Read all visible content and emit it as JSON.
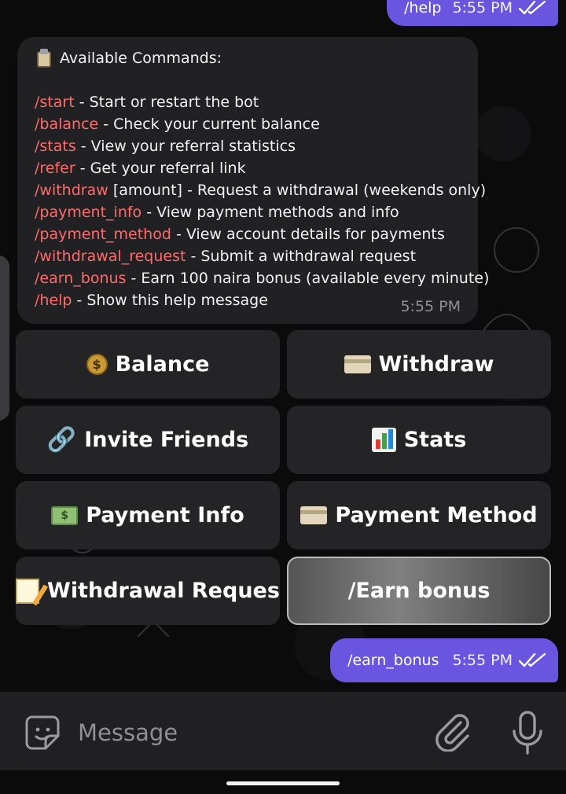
{
  "messages": {
    "outgoing_top": {
      "text": "/help",
      "time": "5:55 PM"
    },
    "help_message": {
      "title": "Available Commands:",
      "commands": [
        {
          "command": "/start",
          "description": " - Start or restart the bot"
        },
        {
          "command": "/balance",
          "description": " - Check your current balance"
        },
        {
          "command": "/stats",
          "description": " - View your referral statistics"
        },
        {
          "command": "/refer",
          "description": " - Get your referral link"
        },
        {
          "command": "/withdraw",
          "description": " [amount] - Request a withdrawal (weekends only)"
        },
        {
          "command": "/payment_info",
          "description": " - View payment methods and info"
        },
        {
          "command": "/payment_method",
          "description": " - View account details for payments"
        },
        {
          "command": "/withdrawal_request",
          "description": " - Submit a withdrawal request"
        },
        {
          "command": "/earn_bonus",
          "description": " - Earn 100 naira bonus (available every minute)"
        },
        {
          "command": "/help",
          "description": " - Show this help message"
        }
      ],
      "time": "5:55 PM",
      "icon": "clipboard-icon"
    },
    "outgoing_bottom": {
      "text": "/earn_bonus",
      "time": "5:55 PM"
    }
  },
  "keyboard": {
    "buttons": [
      {
        "label": "Balance",
        "icon": "money-bag-icon"
      },
      {
        "label": "Withdraw",
        "icon": "credit-card-icon"
      },
      {
        "label": "Invite Friends",
        "icon": "link-icon"
      },
      {
        "label": "Stats",
        "icon": "bar-chart-icon"
      },
      {
        "label": "Payment Info",
        "icon": "cash-icon"
      },
      {
        "label": "Payment Method",
        "icon": "credit-card-icon"
      },
      {
        "label": "Withdrawal Reques",
        "icon": "memo-icon"
      },
      {
        "label": "/Earn bonus"
      }
    ]
  },
  "input": {
    "placeholder": "Message"
  },
  "colors": {
    "command": "#ff6b6b",
    "outgoing_bubble": "#6a55e0",
    "incoming_bubble": "#212124",
    "keyboard_button": "#242426"
  }
}
